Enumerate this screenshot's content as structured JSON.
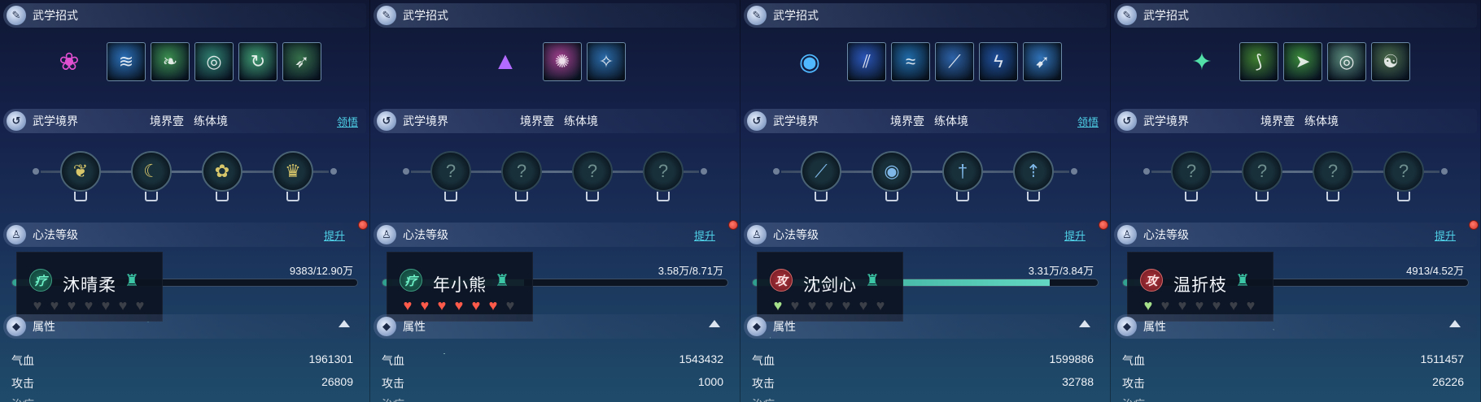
{
  "labels": {
    "skills_title": "武学招式",
    "realm_title": "武学境界",
    "heart_title": "心法等级",
    "attr_title": "属性",
    "realm_level": "境界壹",
    "realm_stage": "练体境",
    "comprehend": "领悟",
    "upgrade": "提升",
    "hp_label": "气血",
    "atk_label": "攻击",
    "third_label_partial": "治疗"
  },
  "colors": {
    "accent_link": "#4fd2e8",
    "exp_fill": "#63d7c2",
    "heart_red": "#ff5a4a",
    "heart_green": "#a6e08a",
    "notify_dot": "#d3322a"
  },
  "panels": [
    {
      "name": "沐晴柔",
      "role": "疗",
      "role_type": "heal",
      "show_comprehend": true,
      "main_skill_icon": "pink-flower-icon",
      "skill_icons": [
        "wave-skill-icon",
        "leaf-slash-icon",
        "vortex-icon",
        "wind-spin-icon",
        "green-dash-icon"
      ],
      "skill_colors": [
        "#2a6fb8",
        "#3b8f4f",
        "#2f7f6f",
        "#3e9a70",
        "#356f49"
      ],
      "nodes_unlocked": true,
      "node_icons": [
        "butterfly-icon",
        "moon-icon",
        "lotus-icon",
        "crown-icon"
      ],
      "exp_text": "9383/12.90万",
      "exp_fraction": 0.073,
      "hearts": [
        "empty",
        "empty",
        "empty",
        "empty",
        "empty",
        "empty",
        "empty"
      ],
      "hp": "1961301",
      "atk": "26809"
    },
    {
      "name": "年小熊",
      "role": "疗",
      "role_type": "heal",
      "show_comprehend": false,
      "main_skill_icon": "purple-crystal-icon",
      "skill_icons": [
        "pink-burst-icon",
        "ice-fan-icon"
      ],
      "skill_colors": [
        "#a33f8e",
        "#2a6aa8"
      ],
      "nodes_unlocked": false,
      "node_icons": [
        "locked-node-icon",
        "locked-node-icon",
        "locked-node-icon",
        "locked-node-icon"
      ],
      "exp_text": "3.58万/8.71万",
      "exp_fraction": 0.411,
      "hearts": [
        "red",
        "red",
        "red",
        "red",
        "red",
        "red",
        "empty"
      ],
      "hp": "1543432",
      "atk": "1000"
    },
    {
      "name": "沈剑心",
      "role": "攻",
      "role_type": "atk",
      "show_comprehend": true,
      "main_skill_icon": "blue-scroll-icon",
      "skill_icons": [
        "sword-rain-icon",
        "blue-wave-icon",
        "blue-slash-icon",
        "lightning-blade-icon",
        "blue-strike-icon"
      ],
      "skill_colors": [
        "#2a55b8",
        "#1f6aa8",
        "#2c62a8",
        "#1e4e9a",
        "#2f72b8"
      ],
      "nodes_unlocked": true,
      "node_icons": [
        "feather-icon",
        "eye-sigil-icon",
        "sword-icon",
        "spear-icon"
      ],
      "exp_text": "3.31万/3.84万",
      "exp_fraction": 0.862,
      "hearts": [
        "green",
        "empty",
        "empty",
        "empty",
        "empty",
        "empty",
        "empty"
      ],
      "hp": "1599886",
      "atk": "32788"
    },
    {
      "name": "温折枝",
      "role": "攻",
      "role_type": "atk",
      "show_comprehend": false,
      "main_skill_icon": "green-phoenix-icon",
      "skill_icons": [
        "green-claw-icon",
        "green-arrow-icon",
        "ring-icon",
        "yin-yang-icon"
      ],
      "skill_colors": [
        "#3f7f2f",
        "#3a8a3a",
        "#5a8a7a",
        "#4a6a4a"
      ],
      "nodes_unlocked": false,
      "node_icons": [
        "locked-node-icon",
        "locked-node-icon",
        "locked-node-icon",
        "locked-node-icon"
      ],
      "exp_text": "4913/4.52万",
      "exp_fraction": 0.109,
      "hearts": [
        "green",
        "empty",
        "empty",
        "empty",
        "empty",
        "empty",
        "empty"
      ],
      "hp": "1511457",
      "atk": "26226"
    }
  ]
}
